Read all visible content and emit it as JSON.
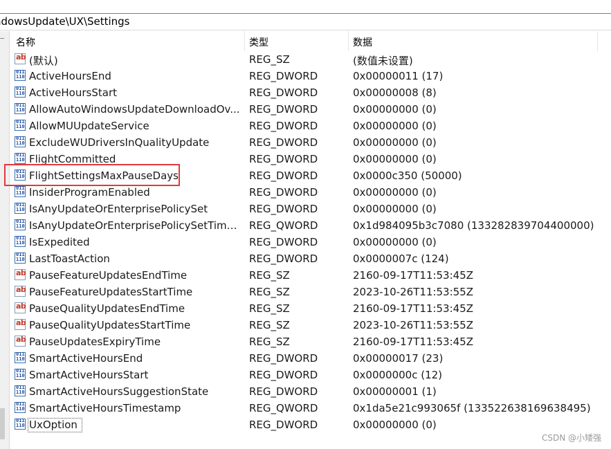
{
  "address": {
    "path": "ndowsUpdate\\UX\\Settings"
  },
  "columns": {
    "name": "名称",
    "type": "类型",
    "data": "数据"
  },
  "rows": [
    {
      "icon": "string-value-icon",
      "name": "(默认)",
      "type": "REG_SZ",
      "data": "(数值未设置)"
    },
    {
      "icon": "binary-value-icon",
      "name": "ActiveHoursEnd",
      "type": "REG_DWORD",
      "data": "0x00000011 (17)"
    },
    {
      "icon": "binary-value-icon",
      "name": "ActiveHoursStart",
      "type": "REG_DWORD",
      "data": "0x00000008 (8)"
    },
    {
      "icon": "binary-value-icon",
      "name": "AllowAutoWindowsUpdateDownloadOv...",
      "type": "REG_DWORD",
      "data": "0x00000000 (0)"
    },
    {
      "icon": "binary-value-icon",
      "name": "AllowMUUpdateService",
      "type": "REG_DWORD",
      "data": "0x00000000 (0)"
    },
    {
      "icon": "binary-value-icon",
      "name": "ExcludeWUDriversInQualityUpdate",
      "type": "REG_DWORD",
      "data": "0x00000000 (0)"
    },
    {
      "icon": "binary-value-icon",
      "name": "FlightCommitted",
      "type": "REG_DWORD",
      "data": "0x00000000 (0)"
    },
    {
      "icon": "binary-value-icon",
      "name": "FlightSettingsMaxPauseDays",
      "type": "REG_DWORD",
      "data": "0x0000c350 (50000)"
    },
    {
      "icon": "binary-value-icon",
      "name": "InsiderProgramEnabled",
      "type": "REG_DWORD",
      "data": "0x00000000 (0)"
    },
    {
      "icon": "binary-value-icon",
      "name": "IsAnyUpdateOrEnterprisePolicySet",
      "type": "REG_DWORD",
      "data": "0x00000000 (0)"
    },
    {
      "icon": "binary-value-icon",
      "name": "IsAnyUpdateOrEnterprisePolicySetTimeS...",
      "type": "REG_QWORD",
      "data": "0x1d984095b3c7080 (133282839704400000)"
    },
    {
      "icon": "binary-value-icon",
      "name": "IsExpedited",
      "type": "REG_DWORD",
      "data": "0x00000000 (0)"
    },
    {
      "icon": "binary-value-icon",
      "name": "LastToastAction",
      "type": "REG_DWORD",
      "data": "0x0000007c (124)"
    },
    {
      "icon": "string-value-icon",
      "name": "PauseFeatureUpdatesEndTime",
      "type": "REG_SZ",
      "data": "2160-09-17T11:53:45Z"
    },
    {
      "icon": "string-value-icon",
      "name": "PauseFeatureUpdatesStartTime",
      "type": "REG_SZ",
      "data": "2023-10-26T11:53:55Z"
    },
    {
      "icon": "string-value-icon",
      "name": "PauseQualityUpdatesEndTime",
      "type": "REG_SZ",
      "data": "2160-09-17T11:53:45Z"
    },
    {
      "icon": "string-value-icon",
      "name": "PauseQualityUpdatesStartTime",
      "type": "REG_SZ",
      "data": "2023-10-26T11:53:55Z"
    },
    {
      "icon": "string-value-icon",
      "name": "PauseUpdatesExpiryTime",
      "type": "REG_SZ",
      "data": "2160-09-17T11:53:45Z"
    },
    {
      "icon": "binary-value-icon",
      "name": "SmartActiveHoursEnd",
      "type": "REG_DWORD",
      "data": "0x00000017 (23)"
    },
    {
      "icon": "binary-value-icon",
      "name": "SmartActiveHoursStart",
      "type": "REG_DWORD",
      "data": "0x0000000c (12)"
    },
    {
      "icon": "binary-value-icon",
      "name": "SmartActiveHoursSuggestionState",
      "type": "REG_DWORD",
      "data": "0x00000001 (1)"
    },
    {
      "icon": "binary-value-icon",
      "name": "SmartActiveHoursTimestamp",
      "type": "REG_QWORD",
      "data": "0x1da5e21c993065f (133522638169638495)"
    },
    {
      "icon": "binary-value-icon",
      "name": "UxOption",
      "type": "REG_DWORD",
      "data": "0x00000000 (0)"
    }
  ],
  "icon_glyphs": {
    "string": "ab",
    "binary": "011\n110"
  },
  "highlighted_row": "FlightSettingsMaxPauseDays",
  "focused_row": "UxOption",
  "watermark": "CSDN @小矮强",
  "colors": {
    "highlight": "#e0393e",
    "string_icon": "#c0392b",
    "binary_icon": "#1f4fa0"
  }
}
